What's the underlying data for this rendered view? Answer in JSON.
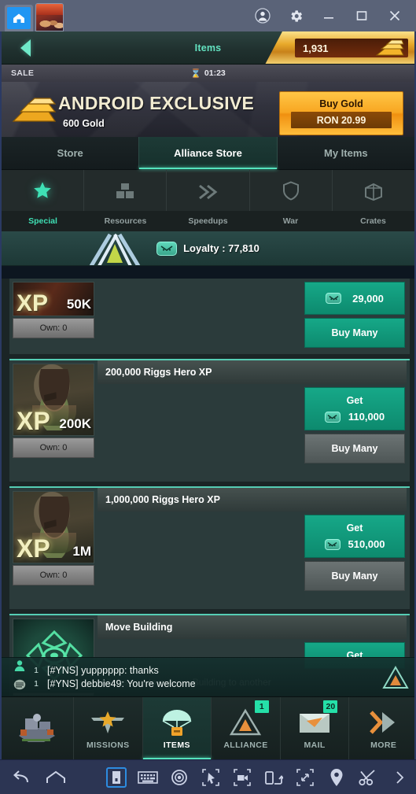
{
  "window": {
    "tabs": [
      {
        "name": "home-tab",
        "icon": "house-icon"
      },
      {
        "name": "game-tab",
        "icon": "game-artwork-icon"
      }
    ],
    "controls": [
      {
        "name": "account-icon",
        "glyph": "account"
      },
      {
        "name": "settings-gear-icon",
        "glyph": "gear"
      },
      {
        "name": "minimize-button",
        "glyph": "minimize"
      },
      {
        "name": "maximize-button",
        "glyph": "maximize"
      },
      {
        "name": "close-button",
        "glyph": "close"
      }
    ]
  },
  "header": {
    "back_icon": "chevron-left-icon",
    "title": "Items",
    "gold_amount": "1,931",
    "gold_icon": "gold-bars-icon"
  },
  "sale": {
    "label": "SALE",
    "timer_icon": "hourglass-icon",
    "timer": "01:23",
    "promo_title": "ANDROID EXCLUSIVE",
    "promo_sub": "600 Gold",
    "promo_icon": "gold-bars-icon",
    "buy_label": "Buy Gold",
    "buy_price": "RON 20.99"
  },
  "main_tabs": [
    {
      "label": "Store",
      "active": false
    },
    {
      "label": "Alliance Store",
      "active": true
    },
    {
      "label": "My Items",
      "active": false
    }
  ],
  "sub_tabs": [
    {
      "label": "Special",
      "icon": "star-icon",
      "active": true
    },
    {
      "label": "Resources",
      "icon": "crates-stack-icon",
      "active": false
    },
    {
      "label": "Speedups",
      "icon": "double-chevron-icon",
      "active": false
    },
    {
      "label": "War",
      "icon": "shield-icon",
      "active": false
    },
    {
      "label": "Crates",
      "icon": "crate-icon",
      "active": false
    }
  ],
  "loyalty": {
    "icon": "loyalty-badge-icon",
    "emblem": "alliance-emblem-icon",
    "text": "Loyalty : 77,810"
  },
  "items": [
    {
      "title": "",
      "title_visible": false,
      "thumb_xp": "XP",
      "thumb_amount": "50K",
      "thumb_kind": "xp-small",
      "own": "Own: 0",
      "description": "",
      "get_label": "",
      "price": "29,000",
      "price_icon": "loyalty-badge-icon",
      "buy_many": "Buy Many",
      "buy_many_state": "green"
    },
    {
      "title": "200,000 Riggs Hero XP",
      "title_visible": true,
      "thumb_xp": "XP",
      "thumb_amount": "200K",
      "thumb_kind": "hero-portrait",
      "own": "Own: 0",
      "description": "",
      "get_label": "Get",
      "price": "110,000",
      "price_icon": "loyalty-badge-icon",
      "buy_many": "Buy Many",
      "buy_many_state": "grey"
    },
    {
      "title": "1,000,000 Riggs Hero XP",
      "title_visible": true,
      "thumb_xp": "XP",
      "thumb_amount": "1M",
      "thumb_kind": "hero-portrait",
      "own": "Own: 0",
      "description": "",
      "get_label": "Get",
      "price": "510,000",
      "price_icon": "loyalty-badge-icon",
      "buy_many": "Buy Many",
      "buy_many_state": "grey"
    },
    {
      "title": "Move Building",
      "title_visible": true,
      "thumb_xp": "",
      "thumb_amount": "",
      "thumb_kind": "move-building",
      "own": "",
      "description": "Allows you to move a Building to another",
      "get_label": "Get",
      "price": "",
      "price_icon": "",
      "buy_many": "",
      "buy_many_state": "none"
    }
  ],
  "chat": {
    "rows": [
      {
        "icon": "person-icon",
        "count": "1",
        "text": "[#YNS] yupppppp: thanks"
      },
      {
        "icon": "chat-bubble-icon",
        "count": "1",
        "text": "[#YNS] debbie49: You're welcome"
      }
    ],
    "emblem": "alliance-emblem-icon"
  },
  "bottom_nav": [
    {
      "label": "",
      "icon": "base-building-icon",
      "active": false,
      "badge": ""
    },
    {
      "label": "MISSIONS",
      "icon": "wings-star-icon",
      "active": false,
      "badge": ""
    },
    {
      "label": "ITEMS",
      "icon": "parachute-crate-icon",
      "active": true,
      "badge": ""
    },
    {
      "label": "ALLIANCE",
      "icon": "alliance-triangle-icon",
      "active": false,
      "badge": "1"
    },
    {
      "label": "MAIL",
      "icon": "envelope-icon",
      "active": false,
      "badge": "20"
    },
    {
      "label": "MORE",
      "icon": "double-chevron-right-icon",
      "active": false,
      "badge": ""
    }
  ],
  "bs_toolbar": {
    "left": [
      {
        "name": "back-icon"
      },
      {
        "name": "home-icon"
      }
    ],
    "right": [
      {
        "name": "multi-instance-icon",
        "boxed": true
      },
      {
        "name": "keyboard-icon",
        "boxed": false
      },
      {
        "name": "eye-icon",
        "boxed": false
      },
      {
        "name": "cursor-macro-icon",
        "boxed": false
      },
      {
        "name": "record-video-icon",
        "boxed": false
      },
      {
        "name": "rotate-screen-icon",
        "boxed": false
      },
      {
        "name": "fullscreen-icon",
        "boxed": false
      },
      {
        "name": "location-pin-icon",
        "boxed": false
      },
      {
        "name": "scissors-icon",
        "boxed": false
      },
      {
        "name": "expand-arrow-icon",
        "boxed": false
      }
    ]
  },
  "colors": {
    "accent_green": "#3fe0b5",
    "gold": "#f8a621",
    "badge_green": "#25e0a8"
  }
}
